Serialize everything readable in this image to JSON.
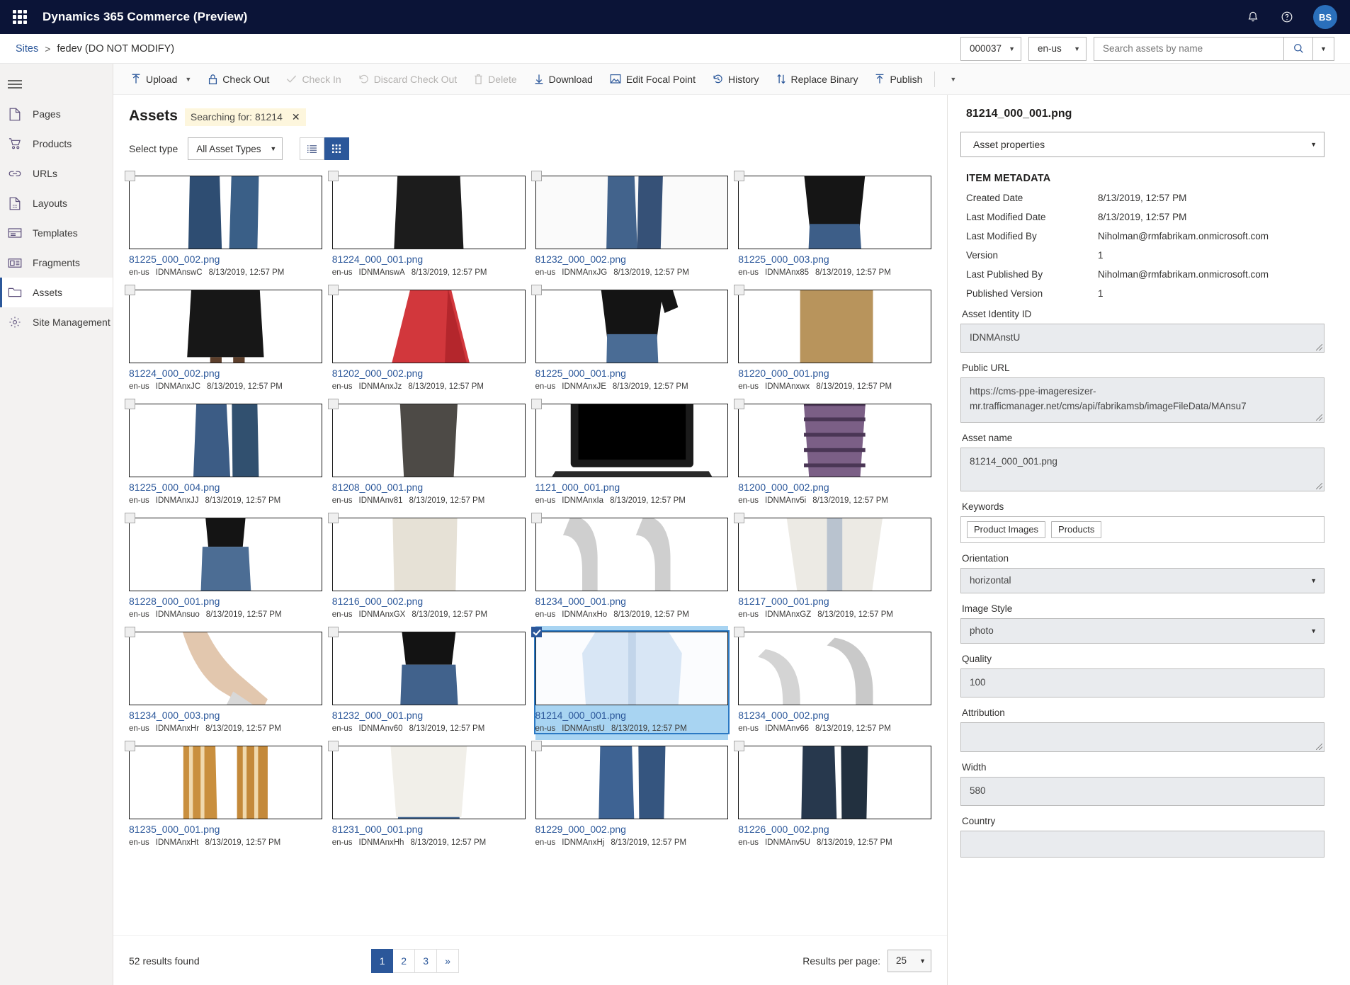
{
  "topbar": {
    "waffle_icon": "app-launcher-icon",
    "title": "Dynamics 365 Commerce (Preview)",
    "notification_icon": "bell-icon",
    "help_icon": "question-mark-icon",
    "avatar_initials": "BS"
  },
  "breadcrumb": {
    "root": "Sites",
    "separator": ">",
    "current": "fedev (DO NOT MODIFY)",
    "channel_value": "000037",
    "locale_value": "en-us",
    "search_placeholder": "Search assets by name",
    "search_value": "",
    "search_icon": "search-icon",
    "search_caret_icon": "chevron-down-icon"
  },
  "sidebar": {
    "hamburger_icon": "hamburger-menu-icon",
    "items": [
      {
        "label": "Pages",
        "icon": "page-icon",
        "active": false
      },
      {
        "label": "Products",
        "icon": "shopping-cart-icon",
        "active": false
      },
      {
        "label": "URLs",
        "icon": "link-icon",
        "active": false
      },
      {
        "label": "Layouts",
        "icon": "layout-icon",
        "active": false
      },
      {
        "label": "Templates",
        "icon": "template-icon",
        "active": false
      },
      {
        "label": "Fragments",
        "icon": "fragment-icon",
        "active": false
      },
      {
        "label": "Assets",
        "icon": "folder-icon",
        "active": true
      },
      {
        "label": "Site Management",
        "icon": "gear-icon",
        "active": false
      }
    ]
  },
  "commandbar": {
    "items": [
      {
        "label": "Upload",
        "icon": "upload-icon",
        "disabled": false,
        "caret": true
      },
      {
        "label": "Check Out",
        "icon": "lock-icon",
        "disabled": false,
        "caret": false
      },
      {
        "label": "Check In",
        "icon": "checkmark-icon",
        "disabled": true,
        "caret": false
      },
      {
        "label": "Discard Check Out",
        "icon": "undo-icon",
        "disabled": true,
        "caret": false
      },
      {
        "label": "Delete",
        "icon": "trash-icon",
        "disabled": true,
        "caret": false
      },
      {
        "label": "Download",
        "icon": "download-icon",
        "disabled": false,
        "caret": false
      },
      {
        "label": "Edit Focal Point",
        "icon": "focal-point-icon",
        "disabled": false,
        "caret": false
      },
      {
        "label": "History",
        "icon": "history-clock-icon",
        "disabled": false,
        "caret": false
      },
      {
        "label": "Replace Binary",
        "icon": "swap-arrows-icon",
        "disabled": false,
        "caret": false
      },
      {
        "label": "Publish",
        "icon": "publish-icon",
        "disabled": false,
        "caret": false
      }
    ],
    "overflow_caret_icon": "chevron-down-icon"
  },
  "assets": {
    "title": "Assets",
    "search_chip_label": "Searching for: 81214",
    "search_chip_close_icon": "close-icon",
    "select_type_label": "Select type",
    "select_type_value": "All Asset Types",
    "select_type_caret_icon": "chevron-down-icon",
    "view_list_icon": "list-view-icon",
    "view_grid_icon": "grid-view-icon",
    "active_view": "grid",
    "results_found": "52 results found",
    "results_per_page_label": "Results per page:",
    "results_per_page_value": "25",
    "results_per_page_caret_icon": "chevron-down-icon",
    "pages": [
      "1",
      "2",
      "3",
      "»"
    ],
    "active_page": "1",
    "tiles": [
      {
        "name": "81225_000_002.png",
        "locale": "en-us",
        "id": "IDNMAnswC",
        "date": "8/13/2019, 12:57 PM",
        "selected": false,
        "art": "jeans-legs-dark"
      },
      {
        "name": "81224_000_001.png",
        "locale": "en-us",
        "id": "IDNMAnswA",
        "date": "8/13/2019, 12:57 PM",
        "selected": false,
        "art": "yellow-top-black-skirt"
      },
      {
        "name": "81232_000_002.png",
        "locale": "en-us",
        "id": "IDNMAnxJG",
        "date": "8/13/2019, 12:57 PM",
        "selected": false,
        "art": "jeans-legs-blue"
      },
      {
        "name": "81225_000_003.png",
        "locale": "en-us",
        "id": "IDNMAnx85",
        "date": "8/13/2019, 12:57 PM",
        "selected": false,
        "art": "black-top-jeans"
      },
      {
        "name": "81224_000_002.png",
        "locale": "en-us",
        "id": "IDNMAnxJC",
        "date": "8/13/2019, 12:57 PM",
        "selected": false,
        "art": "black-skirt-legs"
      },
      {
        "name": "81202_000_002.png",
        "locale": "en-us",
        "id": "IDNMAnxJz",
        "date": "8/13/2019, 12:57 PM",
        "selected": false,
        "art": "red-dress"
      },
      {
        "name": "81225_000_001.png",
        "locale": "en-us",
        "id": "IDNMAnxJE",
        "date": "8/13/2019, 12:57 PM",
        "selected": false,
        "art": "black-longsleeve-jeans"
      },
      {
        "name": "81220_000_001.png",
        "locale": "en-us",
        "id": "IDNMAnxwx",
        "date": "8/13/2019, 12:57 PM",
        "selected": false,
        "art": "tan-blazer-scarf"
      },
      {
        "name": "81225_000_004.png",
        "locale": "en-us",
        "id": "IDNMAnxJJ",
        "date": "8/13/2019, 12:57 PM",
        "selected": false,
        "art": "jeans-flare"
      },
      {
        "name": "81208_000_001.png",
        "locale": "en-us",
        "id": "IDNMAnv81",
        "date": "8/13/2019, 12:57 PM",
        "selected": false,
        "art": "grey-pencil-dress"
      },
      {
        "name": "1121_000_001.png",
        "locale": "en-us",
        "id": "IDNMAnxIa",
        "date": "8/13/2019, 12:57 PM",
        "selected": false,
        "art": "laptop"
      },
      {
        "name": "81200_000_002.png",
        "locale": "en-us",
        "id": "IDNMAnv5i",
        "date": "8/13/2019, 12:57 PM",
        "selected": false,
        "art": "striped-dress"
      },
      {
        "name": "81228_000_001.png",
        "locale": "en-us",
        "id": "IDNMAnsuo",
        "date": "8/13/2019, 12:57 PM",
        "selected": false,
        "art": "black-tank-jeans"
      },
      {
        "name": "81216_000_002.png",
        "locale": "en-us",
        "id": "IDNMAnxGX",
        "date": "8/13/2019, 12:57 PM",
        "selected": false,
        "art": "cream-knit-top"
      },
      {
        "name": "81234_000_001.png",
        "locale": "en-us",
        "id": "IDNMAnxHo",
        "date": "8/13/2019, 12:57 PM",
        "selected": false,
        "art": "heels-pair"
      },
      {
        "name": "81217_000_001.png",
        "locale": "en-us",
        "id": "IDNMAnxGZ",
        "date": "8/13/2019, 12:57 PM",
        "selected": false,
        "art": "white-cardigan"
      },
      {
        "name": "81234_000_003.png",
        "locale": "en-us",
        "id": "IDNMAnxHr",
        "date": "8/13/2019, 12:57 PM",
        "selected": false,
        "art": "heel-on-foot"
      },
      {
        "name": "81232_000_001.png",
        "locale": "en-us",
        "id": "IDNMAnv60",
        "date": "8/13/2019, 12:57 PM",
        "selected": false,
        "art": "black-top-jeans2"
      },
      {
        "name": "81214_000_001.png",
        "locale": "en-us",
        "id": "IDNMAnstU",
        "date": "8/13/2019, 12:57 PM",
        "selected": true,
        "art": "blue-shirt-woman"
      },
      {
        "name": "81234_000_002.png",
        "locale": "en-us",
        "id": "IDNMAnv66",
        "date": "8/13/2019, 12:57 PM",
        "selected": false,
        "art": "heels-grey"
      },
      {
        "name": "81235_000_001.png",
        "locale": "en-us",
        "id": "IDNMAnxHt",
        "date": "8/13/2019, 12:57 PM",
        "selected": false,
        "art": "cowboy-boots"
      },
      {
        "name": "81231_000_001.png",
        "locale": "en-us",
        "id": "IDNMAnxHh",
        "date": "8/13/2019, 12:57 PM",
        "selected": false,
        "art": "white-top-jeans"
      },
      {
        "name": "81229_000_002.png",
        "locale": "en-us",
        "id": "IDNMAnxHj",
        "date": "8/13/2019, 12:57 PM",
        "selected": false,
        "art": "blue-jeans-legs"
      },
      {
        "name": "81226_000_002.png",
        "locale": "en-us",
        "id": "IDNMAnv5U",
        "date": "8/13/2019, 12:57 PM",
        "selected": false,
        "art": "dark-jeans-legs"
      }
    ]
  },
  "detail": {
    "title": "81214_000_001.png",
    "properties_select": "Asset properties",
    "properties_caret_icon": "chevron-down-icon",
    "section_label": "ITEM METADATA",
    "metadata": [
      {
        "key": "Created Date",
        "value": "8/13/2019, 12:57 PM"
      },
      {
        "key": "Last Modified Date",
        "value": "8/13/2019, 12:57 PM"
      },
      {
        "key": "Last Modified By",
        "value": "Niholman@rmfabrikam.onmicrosoft.com"
      },
      {
        "key": "Version",
        "value": "1"
      },
      {
        "key": "Last Published By",
        "value": "Niholman@rmfabrikam.onmicrosoft.com"
      },
      {
        "key": "Published Version",
        "value": "1"
      }
    ],
    "asset_identity_label": "Asset Identity ID",
    "asset_identity_value": "IDNMAnstU",
    "public_url_label": "Public URL",
    "public_url_value": "https://cms-ppe-imageresizer-mr.trafficmanager.net/cms/api/fabrikamsb/imageFileData/MAnsu7",
    "asset_name_label": "Asset name",
    "asset_name_value": "81214_000_001.png",
    "keywords_label": "Keywords",
    "keywords": [
      "Product Images",
      "Products"
    ],
    "orientation_label": "Orientation",
    "orientation_value": "horizontal",
    "orientation_caret_icon": "chevron-down-icon",
    "image_style_label": "Image Style",
    "image_style_value": "photo",
    "image_style_caret_icon": "chevron-down-icon",
    "quality_label": "Quality",
    "quality_value": "100",
    "attribution_label": "Attribution",
    "attribution_value": "",
    "width_label": "Width",
    "width_value": "580",
    "country_label": "Country",
    "country_value": ""
  },
  "colors": {
    "brand_navy": "#0b1437",
    "accent_blue": "#2b579a",
    "selection_blue": "#a8d4f2",
    "chip_yellow": "#fdf6dd"
  }
}
